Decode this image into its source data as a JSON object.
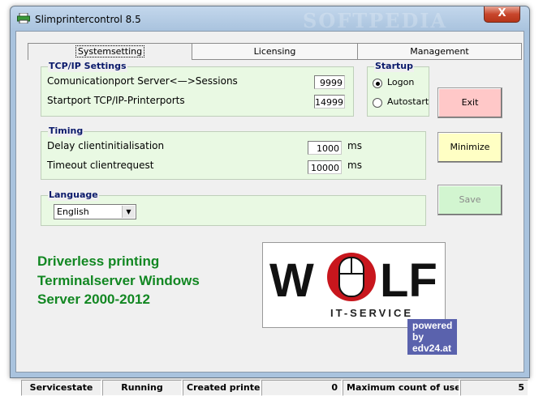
{
  "window": {
    "title": "Slimprintercontrol  8.5",
    "watermark": "SOFTPEDIA",
    "close_symbol": "X"
  },
  "tabs": [
    {
      "label": "Systemsetting",
      "active": true
    },
    {
      "label": "Licensing",
      "active": false
    },
    {
      "label": "Management",
      "active": false
    }
  ],
  "tcpip": {
    "title": "TCP/IP Settings",
    "server_label": "Comunicationport Server<—>Sessions",
    "server_value": "9999",
    "start_label": "Startport TCP/IP-Printerports",
    "start_value": "14999"
  },
  "startup": {
    "title": "Startup",
    "options": [
      "Logon",
      "Autostart"
    ],
    "selected": "Logon"
  },
  "timing": {
    "title": "Timing",
    "delay_label": "Delay clientinitialisation",
    "delay_value": "1000",
    "delay_unit": "ms",
    "timeout_label": "Timeout clientrequest",
    "timeout_value": "10000",
    "timeout_unit": "ms"
  },
  "language": {
    "title": "Language",
    "selected": "English"
  },
  "buttons": {
    "exit": "Exit",
    "minimize": "Minimize",
    "save": "Save"
  },
  "colors": {
    "exit_bg": "#ffc8c8",
    "minimize_bg": "#ffffc4",
    "save_bg": "#d2f5d0",
    "save_text": "#8a8a8a",
    "promo_text": "#128722",
    "group_bg": "#e9f9e3"
  },
  "promo": {
    "line1": "Driverless printing",
    "line2": "Terminalserver Windows",
    "line3": "Server 2000-2012"
  },
  "logo": {
    "brand_letters": "WOLF",
    "subtitle": "IT-SERVICE",
    "powered": "powered by edv24.at"
  },
  "statusbar": {
    "servicestate_label": "Servicestate",
    "servicestate_value": "Running",
    "created_label": "Created printers",
    "created_value": "0",
    "max_label": "Maximum count of users",
    "max_value": "5"
  }
}
